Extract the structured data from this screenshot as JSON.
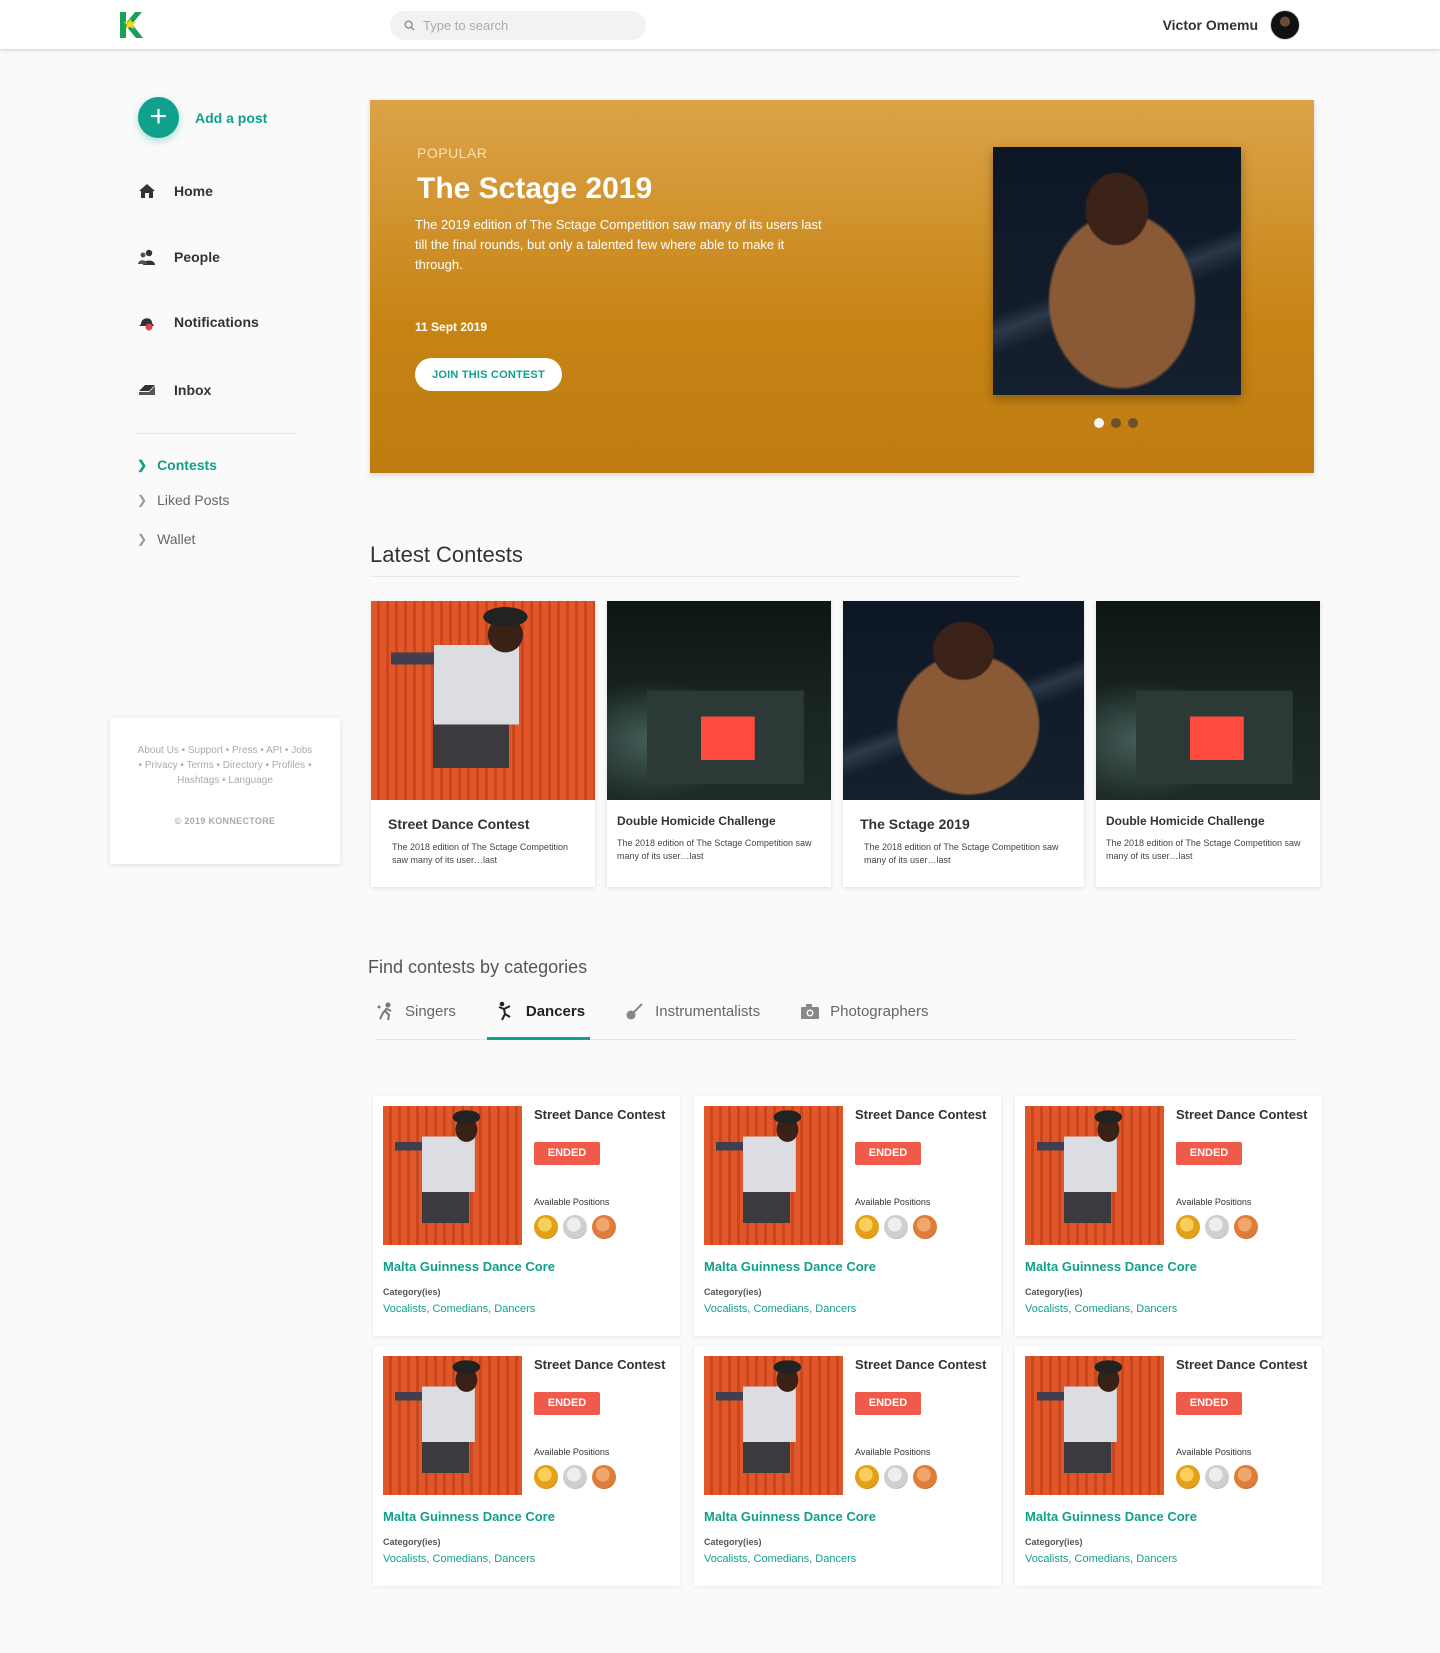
{
  "header": {
    "logo_letter": "K",
    "search_placeholder": "Type to search",
    "user_name": "Victor Omemu"
  },
  "sidebar": {
    "add_post": "Add a post",
    "nav": [
      {
        "label": "Home",
        "icon": "home-icon"
      },
      {
        "label": "People",
        "icon": "people-icon"
      },
      {
        "label": "Notifications",
        "icon": "notifications-icon"
      },
      {
        "label": "Inbox",
        "icon": "inbox-icon"
      }
    ],
    "sub": [
      {
        "label": "Contests",
        "active": true
      },
      {
        "label": "Liked Posts",
        "active": false
      },
      {
        "label": "Wallet",
        "active": false
      }
    ]
  },
  "footer": {
    "links_line1": "About Us • Support • Press • API • Jobs",
    "links_line2": "• Privacy • Terms • Directory • Profiles •",
    "links_line3": "Hashtags • Language",
    "copyright": "© 2019 KONNECTORE"
  },
  "hero": {
    "kicker": "POPULAR",
    "title": "The Sctage 2019",
    "description": "The 2019 edition of The Sctage Competition saw many of its users last till the final rounds, but only a talented few where able to make it through.",
    "date": "11 Sept 2019",
    "cta": "JOIN THIS CONTEST",
    "slide_count": 3,
    "active_slide": 1
  },
  "latest": {
    "title": "Latest Contests",
    "cards": [
      {
        "title": "Street Dance Contest",
        "desc": "The 2018 edition of The Sctage Competition saw many of its user…last"
      },
      {
        "title": "Double Homicide Challenge",
        "desc": "The 2018 edition of The Sctage Competition saw many of its user…last"
      },
      {
        "title": "The Sctage 2019",
        "desc": "The 2018 edition of The Sctage Competition saw many of its user…last"
      },
      {
        "title": "Double Homicide Challenge",
        "desc": "The 2018 edition of The Sctage Competition saw many of its user…last"
      }
    ]
  },
  "categories": {
    "title": "Find contests by categories",
    "tabs": [
      {
        "label": "Singers",
        "icon": "singer-icon",
        "active": false
      },
      {
        "label": "Dancers",
        "icon": "dancer-icon",
        "active": true
      },
      {
        "label": "Instrumentalists",
        "icon": "guitar-icon",
        "active": false
      },
      {
        "label": "Photographers",
        "icon": "camera-icon",
        "active": false
      }
    ],
    "card": {
      "title": "Street Dance Contest",
      "status": "ENDED",
      "positions_label": "Available Positions",
      "organizer": "Malta Guinness Dance Core",
      "category_label": "Category(ies)",
      "category_values": "Vocalists, Comedians, Dancers",
      "medals": [
        "gold",
        "silver",
        "bronze"
      ]
    }
  },
  "colors": {
    "accent": "#11a08b",
    "hero_gold": "#c78415",
    "ended_badge": "#f05a4a"
  }
}
